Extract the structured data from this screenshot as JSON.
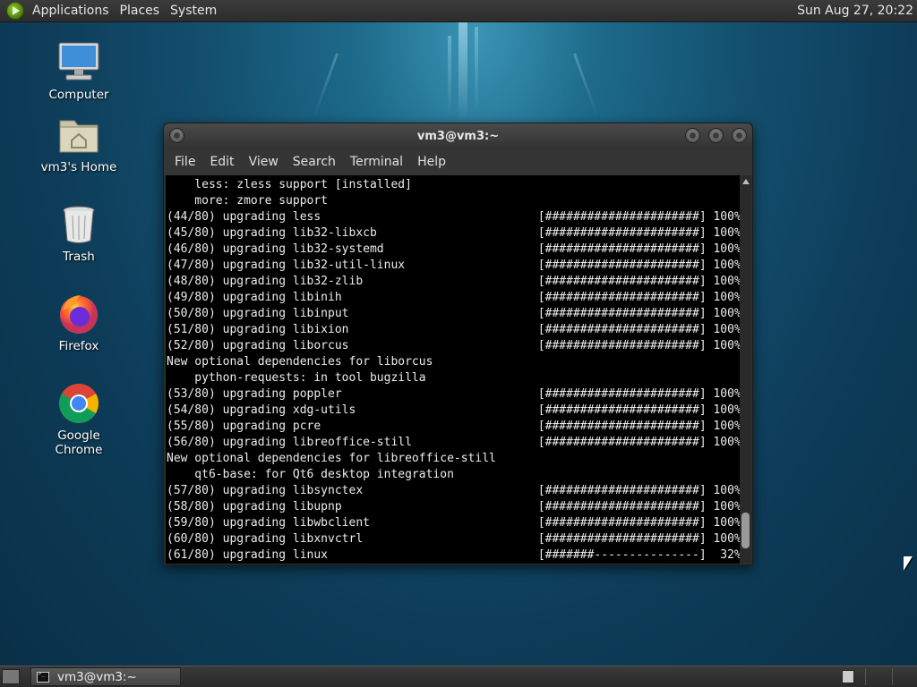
{
  "top_panel": {
    "menus": [
      "Applications",
      "Places",
      "System"
    ],
    "clock": "Sun Aug 27, 20:22"
  },
  "desktop_icons": [
    {
      "label": "Computer",
      "icon": "computer-icon"
    },
    {
      "label": "vm3's Home",
      "icon": "home-folder-icon"
    },
    {
      "label": "Trash",
      "icon": "trash-icon"
    },
    {
      "label": "Firefox",
      "icon": "firefox-icon"
    },
    {
      "label": "Google Chrome",
      "icon": "chrome-icon"
    }
  ],
  "terminal": {
    "title": "vm3@vm3:~",
    "menus": [
      "File",
      "Edit",
      "View",
      "Search",
      "Terminal",
      "Help"
    ],
    "lines": [
      "    less: zless support [installed]",
      "    more: zmore support",
      "(44/80) upgrading less                               [######################] 100%",
      "(45/80) upgrading lib32-libxcb                       [######################] 100%",
      "(46/80) upgrading lib32-systemd                      [######################] 100%",
      "(47/80) upgrading lib32-util-linux                   [######################] 100%",
      "(48/80) upgrading lib32-zlib                         [######################] 100%",
      "(49/80) upgrading libinih                            [######################] 100%",
      "(50/80) upgrading libinput                           [######################] 100%",
      "(51/80) upgrading libixion                           [######################] 100%",
      "(52/80) upgrading liborcus                           [######################] 100%",
      "New optional dependencies for liborcus",
      "    python-requests: in tool bugzilla",
      "(53/80) upgrading poppler                            [######################] 100%",
      "(54/80) upgrading xdg-utils                          [######################] 100%",
      "(55/80) upgrading pcre                               [######################] 100%",
      "(56/80) upgrading libreoffice-still                  [######################] 100%",
      "New optional dependencies for libreoffice-still",
      "    qt6-base: for Qt6 desktop integration",
      "(57/80) upgrading libsynctex                         [######################] 100%",
      "(58/80) upgrading libupnp                            [######################] 100%",
      "(59/80) upgrading libwbclient                        [######################] 100%",
      "(60/80) upgrading libxnvctrl                         [######################] 100%",
      "(61/80) upgrading linux                              [#######---------------]  32%"
    ]
  },
  "taskbar": {
    "task_label": "vm3@vm3:~"
  }
}
